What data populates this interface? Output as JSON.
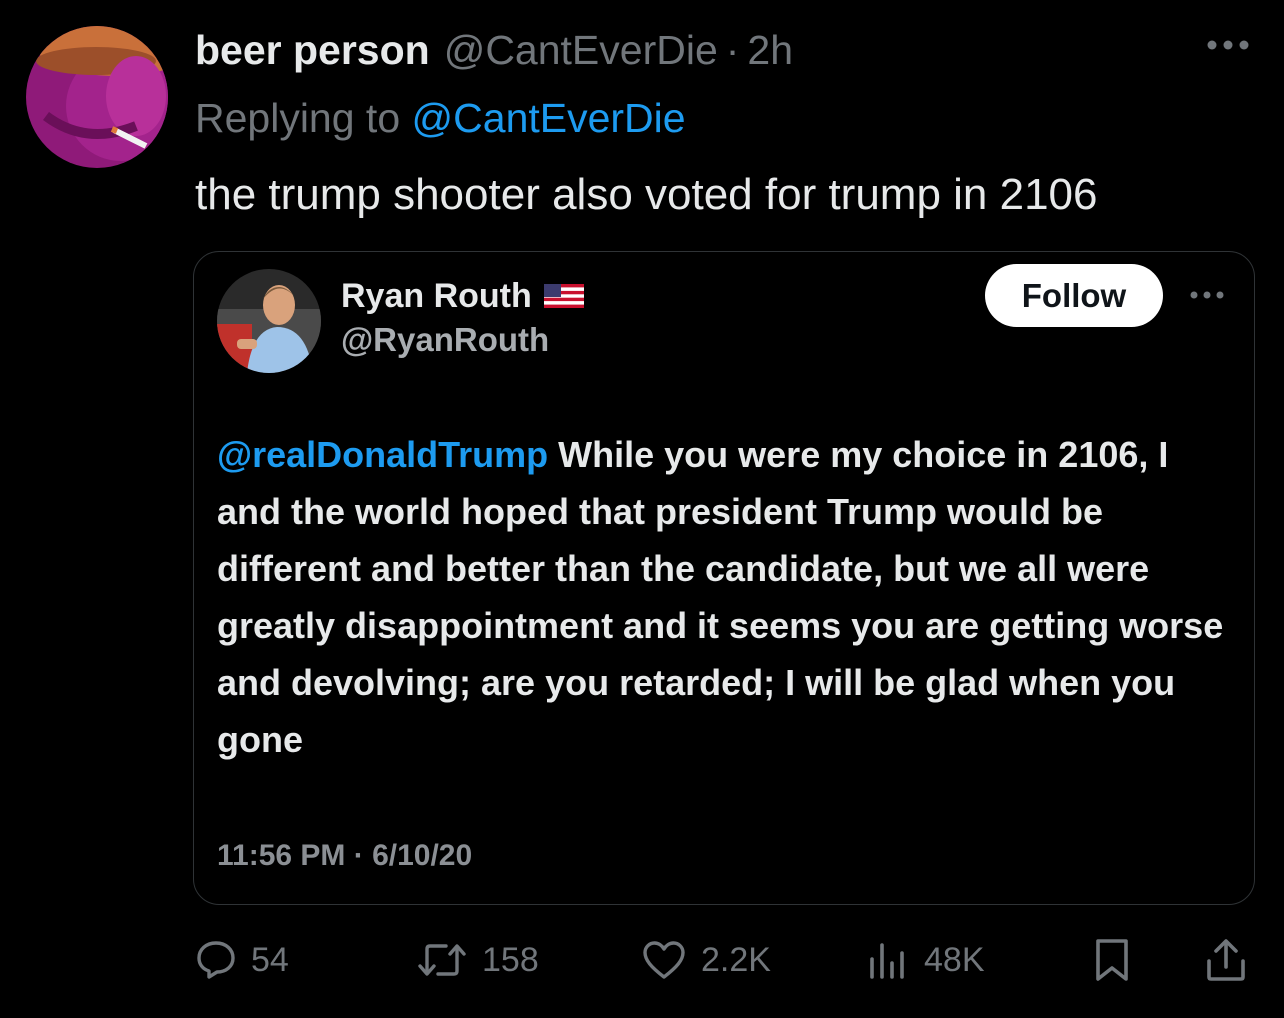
{
  "tweet": {
    "display_name": "beer person",
    "handle": "@CantEverDie",
    "separator": "·",
    "time": "2h",
    "replying_prefix": "Replying to",
    "replying_handle": "@CantEverDie",
    "text": "the trump shooter also voted for trump in 2106"
  },
  "embed": {
    "display_name": "Ryan Routh",
    "handle": "@RyanRouth",
    "follow_label": "Follow",
    "mention": "@realDonaldTrump",
    "body": " While you were my choice in 2106, I and the world hoped that president Trump would be different and better than the candidate, but we all were greatly disappointment and it seems you are getting worse and devolving; are you retarded; I will be glad when you gone",
    "timestamp": "11:56 PM · 6/10/20"
  },
  "actions": {
    "replies": "54",
    "retweets": "158",
    "likes": "2.2K",
    "views": "48K"
  },
  "icons": {
    "more": "more-horizontal-icon",
    "flag": "us-flag-icon",
    "reply": "reply-bubble-icon",
    "retweet": "retweet-icon",
    "like": "heart-icon",
    "views": "views-bar-icon",
    "bookmark": "bookmark-icon",
    "share": "share-icon"
  },
  "colors": {
    "background": "#000000",
    "text_primary": "#e7e9ea",
    "text_secondary": "#71767b",
    "accent": "#1d9bf0",
    "border": "#2f3336"
  }
}
